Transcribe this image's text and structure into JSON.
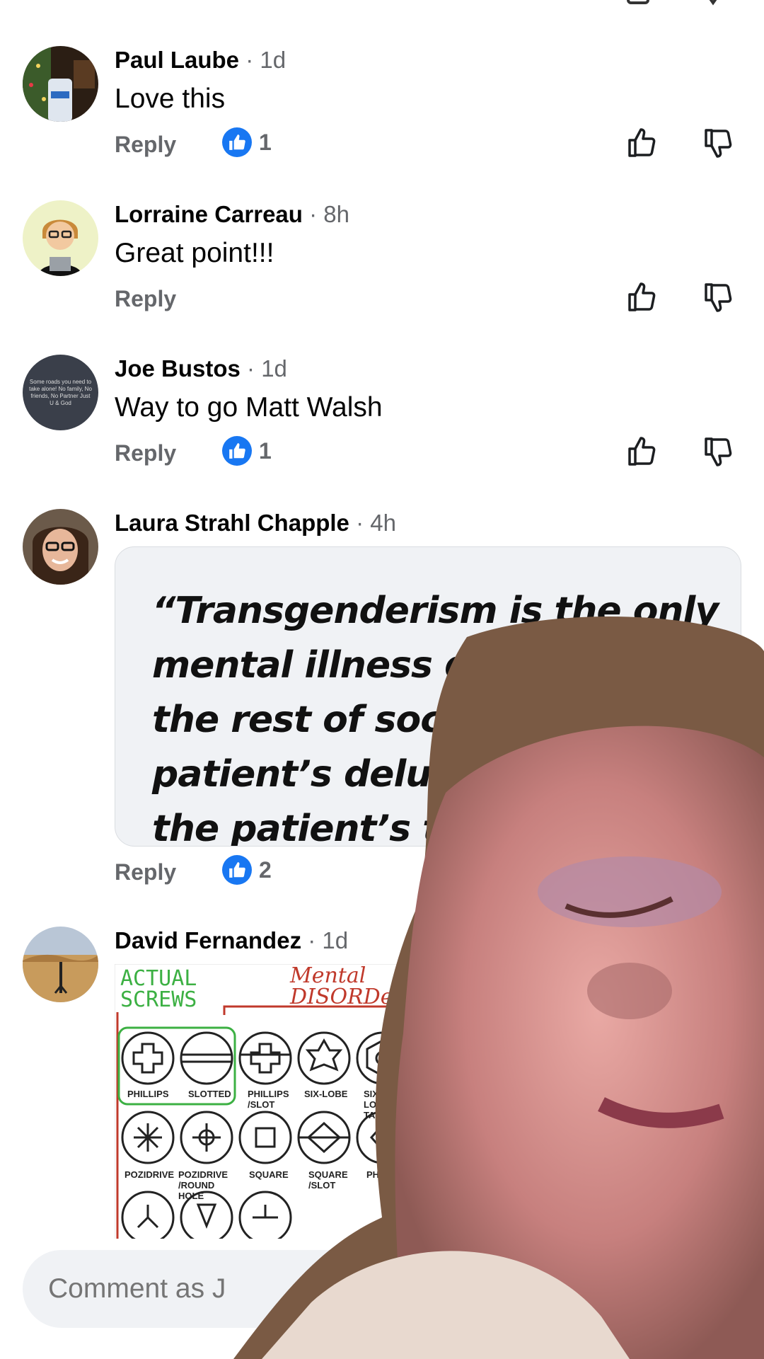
{
  "comments": [
    {
      "name": "Paul Laube",
      "time": "· 1d",
      "text": "Love this",
      "reply": "Reply",
      "likes": "1"
    },
    {
      "name": "Lorraine Carreau",
      "time": "· 8h",
      "text": "Great point!!!",
      "reply": "Reply"
    },
    {
      "name": "Joe Bustos",
      "time": "· 1d",
      "text": "Way to go Matt Walsh",
      "reply": "Reply",
      "likes": "1",
      "avatar_text": "Some roads you need to take alone! No family, No friends, No Partner Just U & God"
    },
    {
      "name": "Laura Strahl Chapple",
      "time": "· 4h",
      "reply": "Reply",
      "likes": "2",
      "image_text": "“Transgenderism is the only\nmental illness demanding th\nthe rest of society ad\npatient’s delusion a\nthe patient’s treat"
    },
    {
      "name": "David Fernandez",
      "time": "· 1d",
      "image": {
        "title_left": [
          "ACTUAL",
          "SCREWS"
        ],
        "title_right": [
          "Mental",
          "DISORDers"
        ],
        "row1": [
          "PHILLIPS",
          "SLOTTED",
          "PHILLIPS /SLOT",
          "SIX-LOBE",
          "SIX-LOBE TAMPER"
        ],
        "row2": [
          "POZIDRIVE",
          "POZIDRIVE /ROUND HOLE",
          "SQUARE",
          "SQUARE /SLOT",
          "PHILLIPS"
        ]
      }
    }
  ],
  "composer": {
    "placeholder": "Comment as J"
  },
  "colors": {
    "accent": "#1877f2",
    "muted": "#65676b",
    "bubble": "#f0f2f5"
  }
}
